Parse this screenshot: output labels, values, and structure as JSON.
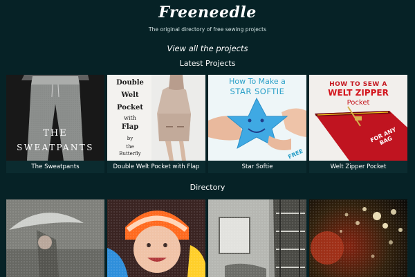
{
  "site": {
    "logo": "Freeneedle",
    "tagline": "The original directory of free sewing projects",
    "view_all_label": "View all the projects"
  },
  "latest": {
    "title": "Latest Projects",
    "items": [
      {
        "caption": "The Sweatpants",
        "image_text": [
          "THE",
          "SWEATPANTS"
        ]
      },
      {
        "caption": "Double Welt Pocket with Flap",
        "image_text": [
          "Double",
          "Welt",
          "Pocket",
          "with",
          "Flap",
          "by",
          "the",
          "Butterfly"
        ]
      },
      {
        "caption": "Star Softie",
        "image_text": [
          "How To Make a",
          "STAR SOFTIE",
          "FREE"
        ]
      },
      {
        "caption": "Welt Zipper Pocket",
        "image_text": [
          "HOW TO SEW A",
          "WELT ZIPPER",
          "Pocket",
          "FOR ANY BAG"
        ]
      }
    ]
  },
  "directory": {
    "title": "Directory",
    "items": [
      {
        "image": "umbrella-photo"
      },
      {
        "image": "child-hat-photo"
      },
      {
        "image": "fire-escape-photo"
      },
      {
        "image": "lights-photo"
      }
    ]
  }
}
